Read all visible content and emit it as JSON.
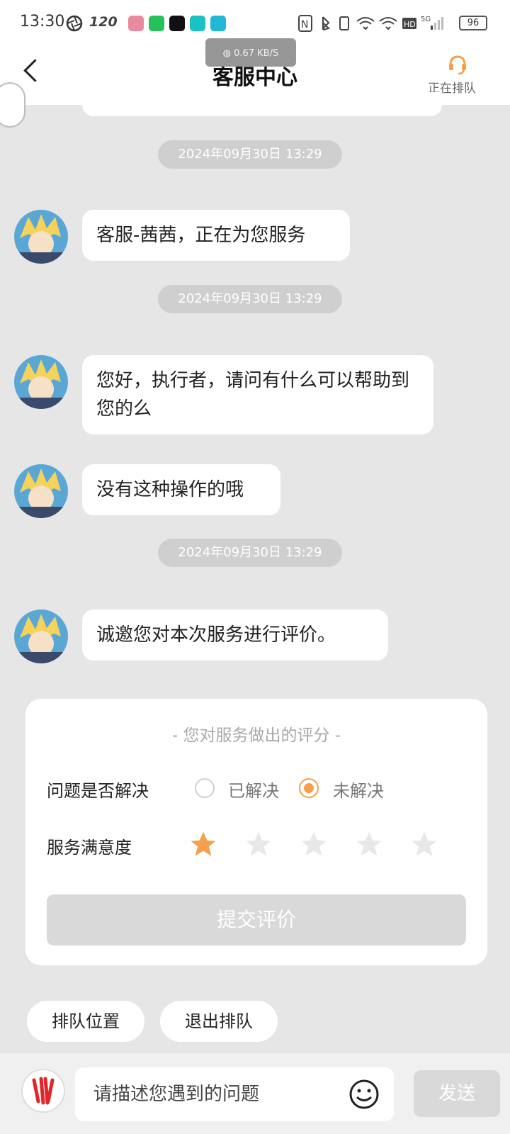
{
  "status_bar": {
    "time": "13:30",
    "refresh_rate": "120",
    "battery": "96"
  },
  "header": {
    "title": "客服中心",
    "net_speed": "0.67 KB/S",
    "queue_status": "正在排队"
  },
  "timestamps": [
    "2024年09月30日 13:29",
    "2024年09月30日 13:29",
    "2024年09月30日 13:29"
  ],
  "messages": [
    {
      "text": "客服-茜茜，正在为您服务"
    },
    {
      "text": "您好，执行者，请问有什么可以帮助到您的么"
    },
    {
      "text": "没有这种操作的哦"
    },
    {
      "text": "诚邀您对本次服务进行评价。"
    }
  ],
  "rating": {
    "title": "- 您对服务做出的评分 -",
    "resolved_label": "问题是否解决",
    "option_resolved": "已解决",
    "option_unresolved": "未解决",
    "selected": "未解决",
    "satisfaction_label": "服务满意度",
    "stars_selected": 1,
    "stars_total": 5,
    "submit": "提交评价",
    "accent_color": "#f4a04c"
  },
  "quick_actions": [
    "排队位置",
    "退出排队"
  ],
  "input": {
    "placeholder": "请描述您遇到的问题",
    "send": "发送"
  }
}
